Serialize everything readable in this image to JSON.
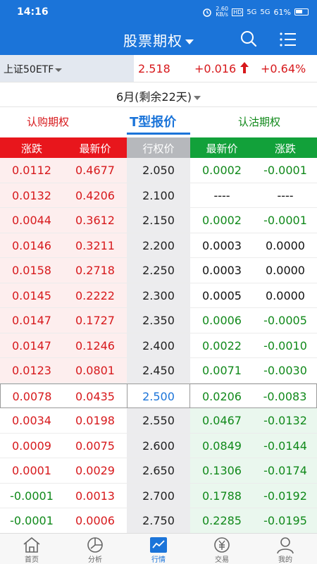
{
  "status": {
    "time": "14:16",
    "speed": "2.60\nKB/s",
    "hd": "HD",
    "sig1": "5G",
    "sig2": "5G",
    "battery": "61%"
  },
  "header": {
    "title": "股票期权"
  },
  "quote": {
    "underlying": "上证50ETF",
    "price": "2.518",
    "change": "+0.016",
    "pct": "+0.64%"
  },
  "expiry": {
    "label": "6月(剩余22天)"
  },
  "tabs": {
    "call": "认购期权",
    "t_quote": "T型报价",
    "put": "认沽期权"
  },
  "columns": {
    "call_change": "涨跌",
    "call_last": "最新价",
    "strike": "行权价",
    "put_last": "最新价",
    "put_change": "涨跌"
  },
  "rows": [
    {
      "call_change": "0.0112",
      "call_last": "0.4677",
      "strike": "2.050",
      "put_last": "0.0002",
      "put_change": "-0.0001"
    },
    {
      "call_change": "0.0132",
      "call_last": "0.4206",
      "strike": "2.100",
      "put_last": "----",
      "put_change": "----"
    },
    {
      "call_change": "0.0044",
      "call_last": "0.3612",
      "strike": "2.150",
      "put_last": "0.0002",
      "put_change": "-0.0001"
    },
    {
      "call_change": "0.0146",
      "call_last": "0.3211",
      "strike": "2.200",
      "put_last": "0.0003",
      "put_change": "0.0000"
    },
    {
      "call_change": "0.0158",
      "call_last": "0.2718",
      "strike": "2.250",
      "put_last": "0.0003",
      "put_change": "0.0000"
    },
    {
      "call_change": "0.0145",
      "call_last": "0.2222",
      "strike": "2.300",
      "put_last": "0.0005",
      "put_change": "0.0000"
    },
    {
      "call_change": "0.0147",
      "call_last": "0.1727",
      "strike": "2.350",
      "put_last": "0.0006",
      "put_change": "-0.0005"
    },
    {
      "call_change": "0.0147",
      "call_last": "0.1246",
      "strike": "2.400",
      "put_last": "0.0022",
      "put_change": "-0.0010"
    },
    {
      "call_change": "0.0123",
      "call_last": "0.0801",
      "strike": "2.450",
      "put_last": "0.0071",
      "put_change": "-0.0030"
    },
    {
      "call_change": "0.0078",
      "call_last": "0.0435",
      "strike": "2.500",
      "put_last": "0.0206",
      "put_change": "-0.0083"
    },
    {
      "call_change": "0.0034",
      "call_last": "0.0198",
      "strike": "2.550",
      "put_last": "0.0467",
      "put_change": "-0.0132"
    },
    {
      "call_change": "0.0009",
      "call_last": "0.0075",
      "strike": "2.600",
      "put_last": "0.0849",
      "put_change": "-0.0144"
    },
    {
      "call_change": "0.0001",
      "call_last": "0.0029",
      "strike": "2.650",
      "put_last": "0.1306",
      "put_change": "-0.0174"
    },
    {
      "call_change": "-0.0001",
      "call_last": "0.0013",
      "strike": "2.700",
      "put_last": "0.1788",
      "put_change": "-0.0192"
    },
    {
      "call_change": "-0.0001",
      "call_last": "0.0006",
      "strike": "2.750",
      "put_last": "0.2285",
      "put_change": "-0.0195"
    }
  ],
  "nav": {
    "home": "首页",
    "analysis": "分析",
    "market": "行情",
    "trade": "交易",
    "mine": "我的"
  },
  "colors": {
    "brand": "#1b74d9",
    "up": "#d7191c",
    "down": "#10891a",
    "call_header": "#e8161c",
    "put_header": "#12a13a"
  }
}
